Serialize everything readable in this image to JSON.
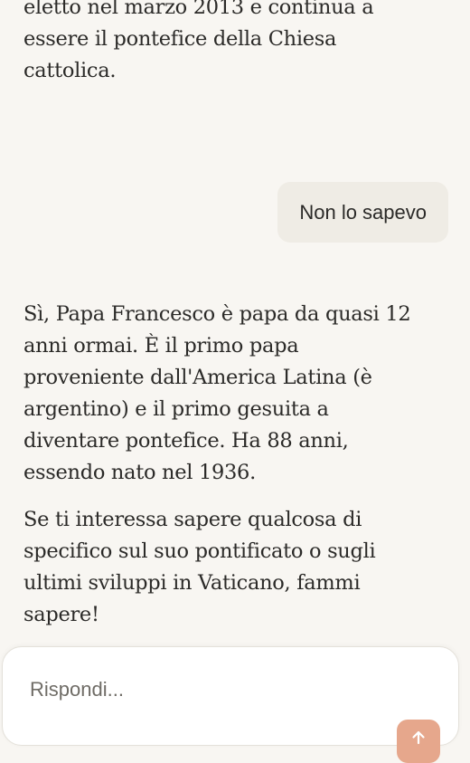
{
  "chat": {
    "messages": [
      {
        "role": "assistant",
        "paragraphs": [
          "eletto nel marzo 2013 e continua a essere il pontefice della Chiesa cattolica."
        ]
      },
      {
        "role": "user",
        "text": "Non lo sapevo"
      },
      {
        "role": "assistant",
        "paragraphs": [
          "Sì, Papa Francesco è papa da quasi 12 anni ormai. È il primo papa proveniente dall'America Latina (è argentino) e il primo gesuita a diventare pontefice. Ha 88 anni, essendo nato nel 1936.",
          "Se ti interessa sapere qualcosa di specifico sul suo pontificato o sugli ultimi sviluppi in Vaticano, fammi sapere!"
        ]
      }
    ]
  },
  "composer": {
    "placeholder": "Rispondi...",
    "value": "",
    "send_icon": "arrow-up-icon",
    "send_color": "#e6a78c"
  },
  "colors": {
    "background": "#f8f6f2",
    "user_bubble": "#efece5",
    "text": "#2b2a28"
  }
}
